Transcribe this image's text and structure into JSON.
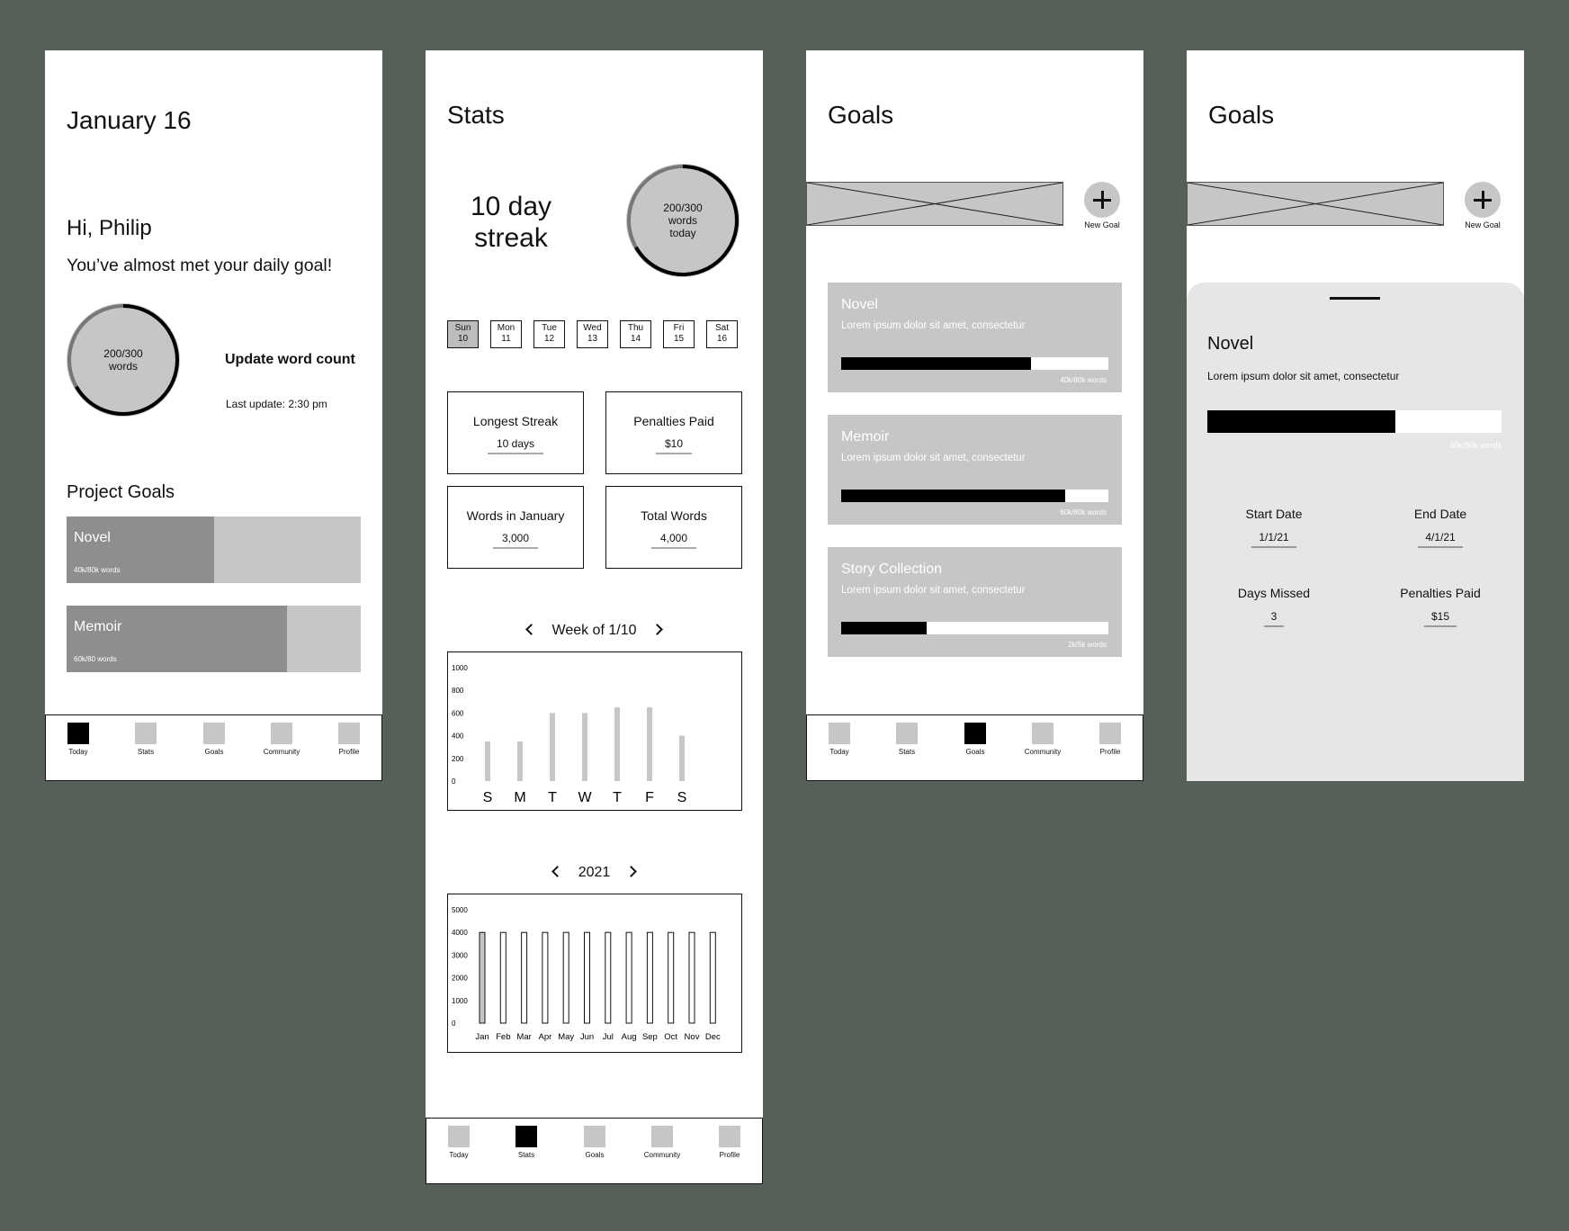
{
  "nav": {
    "today": "Today",
    "stats": "Stats",
    "goals": "Goals",
    "community": "Community",
    "profile": "Profile"
  },
  "colors": {
    "background": "#566058",
    "active_nav": "#000000",
    "inactive_nav": "#c6c6c6",
    "card": "#c6c6c6"
  },
  "today": {
    "date": "January 16",
    "greeting": "Hi, Philip",
    "message": "You’ve almost met your daily goal!",
    "ring_count": "200/300",
    "ring_unit": "words",
    "ring_progress": 0.667,
    "update_label": "Update word count",
    "last_update": "Last update: 2:30 pm",
    "project_goals_title": "Project Goals",
    "projects": [
      {
        "name": "Novel",
        "count": "40k/80k words",
        "progress": 0.5
      },
      {
        "name": "Memoir",
        "count": "60k/80 words",
        "progress": 0.75
      }
    ]
  },
  "stats": {
    "title": "Stats",
    "streak_line1": "10 day",
    "streak_line2": "streak",
    "ring_count": "200/300",
    "ring_unit": "words",
    "ring_sub": "today",
    "ring_progress": 0.667,
    "days": [
      {
        "dow": "Sun",
        "num": "10",
        "selected": true
      },
      {
        "dow": "Mon",
        "num": "11"
      },
      {
        "dow": "Tue",
        "num": "12"
      },
      {
        "dow": "Wed",
        "num": "13"
      },
      {
        "dow": "Thu",
        "num": "14"
      },
      {
        "dow": "Fri",
        "num": "15"
      },
      {
        "dow": "Sat",
        "num": "16"
      }
    ],
    "boxes": [
      {
        "label": "Longest Streak",
        "value": "10 days"
      },
      {
        "label": "Penalties Paid",
        "value": "$10"
      },
      {
        "label": "Words in January",
        "value": "3,000"
      },
      {
        "label": "Total Words",
        "value": "4,000"
      }
    ],
    "week_label": "Week of 1/10",
    "year_label": "2021"
  },
  "chart_data": [
    {
      "type": "bar",
      "title": "Week of 1/10",
      "categories": [
        "S",
        "M",
        "T",
        "W",
        "T",
        "F",
        "S"
      ],
      "values": [
        350,
        350,
        600,
        600,
        650,
        650,
        400
      ],
      "yticks": [
        "1000",
        "800",
        "600",
        "400",
        "200",
        "0"
      ],
      "ylim": [
        0,
        1000
      ]
    },
    {
      "type": "bar",
      "title": "2021",
      "categories": [
        "Jan",
        "Feb",
        "Mar",
        "Apr",
        "May",
        "Jun",
        "Jul",
        "Aug",
        "Sep",
        "Oct",
        "Nov",
        "Dec"
      ],
      "values": [
        4000,
        4000,
        4000,
        4000,
        4000,
        4000,
        4000,
        4000,
        4000,
        4000,
        4000,
        4000
      ],
      "yticks": [
        "5000",
        "4000",
        "3000",
        "2000",
        "1000",
        "0"
      ],
      "ylim": [
        0,
        5000
      ]
    }
  ],
  "goals": {
    "title": "Goals",
    "new_goal": "New Goal",
    "items": [
      {
        "name": "Novel",
        "desc": "Lorem ipsum dolor sit amet, consectetur",
        "count": "40k/80k words",
        "progress": 0.71
      },
      {
        "name": "Memoir",
        "desc": "Lorem ipsum dolor sit amet, consectetur",
        "count": "60k/80k words",
        "progress": 0.84
      },
      {
        "name": "Story Collection",
        "desc": "Lorem ipsum dolor sit amet, consectetur",
        "count": "2k/5k words",
        "progress": 0.32
      }
    ]
  },
  "detail": {
    "title": "Goals",
    "new_goal": "New Goal",
    "name": "Novel",
    "desc": "Lorem ipsum dolor sit amet, consectetur",
    "count": "40k/80k words",
    "progress": 0.64,
    "start_label": "Start Date",
    "start_value": "1/1/21",
    "end_label": "End Date",
    "end_value": "4/1/21",
    "missed_label": "Days Missed",
    "missed_value": "3",
    "penalties_label": "Penalties Paid",
    "penalties_value": "$15"
  }
}
